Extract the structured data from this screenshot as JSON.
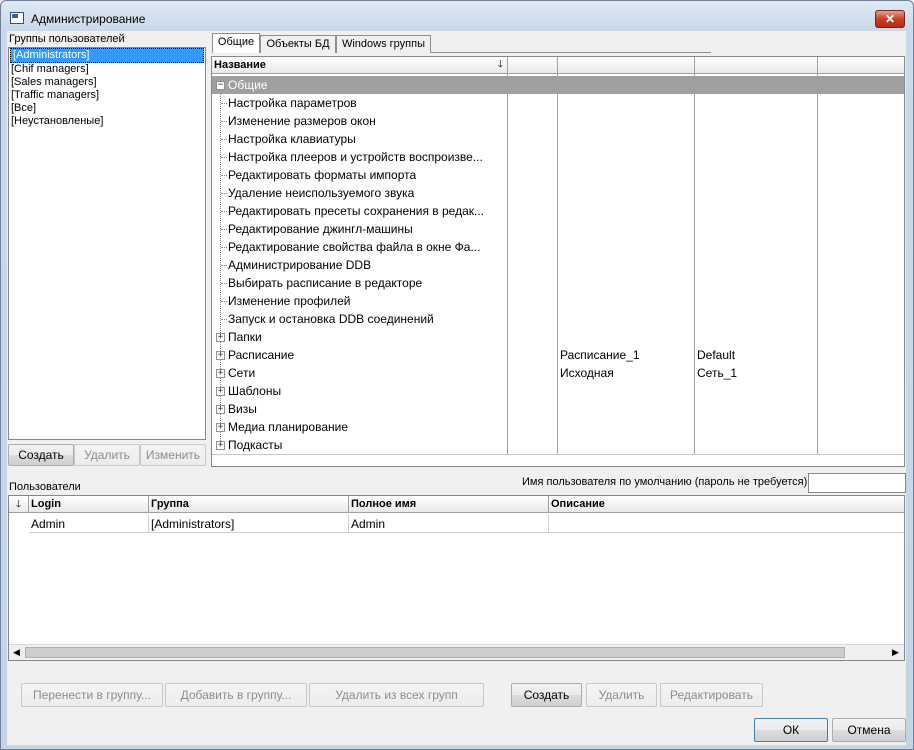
{
  "window": {
    "title": "Администрирование",
    "close_glyph": "✕"
  },
  "groups": {
    "label": "Группы пользователей",
    "items": [
      "[Administrators]",
      "[Chif managers]",
      "[Sales managers]",
      "[Traffic managers]",
      "[Все]",
      "[Неустановленые]"
    ],
    "selected_index": 0,
    "create_label": "Создать",
    "delete_label": "Удалить",
    "edit_label": "Изменить"
  },
  "tabs": [
    {
      "label": "Общие",
      "active": true
    },
    {
      "label": "Объекты БД",
      "active": false
    },
    {
      "label": "Windows группы",
      "active": false
    }
  ],
  "rights": {
    "column_name_header": "Название",
    "sort_glyph": "🡓",
    "rows": [
      {
        "label": "Общие",
        "level": 0,
        "expander": "−",
        "selected": true,
        "col2": "",
        "col3": ""
      },
      {
        "label": "Настройка параметров",
        "level": 1,
        "col2": "",
        "col3": ""
      },
      {
        "label": "Изменение размеров окон",
        "level": 1,
        "col2": "",
        "col3": ""
      },
      {
        "label": "Настройка клавиатуры",
        "level": 1,
        "col2": "",
        "col3": ""
      },
      {
        "label": "Настройка плееров и устройств воспроизве...",
        "level": 1,
        "col2": "",
        "col3": ""
      },
      {
        "label": "Редактировать форматы импорта",
        "level": 1,
        "col2": "",
        "col3": ""
      },
      {
        "label": "Удаление неиспользуемого звука",
        "level": 1,
        "col2": "",
        "col3": ""
      },
      {
        "label": "Редактировать пресеты сохранения в редак...",
        "level": 1,
        "col2": "",
        "col3": ""
      },
      {
        "label": "Редактирование джингл-машины",
        "level": 1,
        "col2": "",
        "col3": ""
      },
      {
        "label": "Редактирование свойства файла в окне Фа...",
        "level": 1,
        "col2": "",
        "col3": ""
      },
      {
        "label": "Администрирование DDB",
        "level": 1,
        "col2": "",
        "col3": ""
      },
      {
        "label": "Выбирать расписание в редакторе",
        "level": 1,
        "col2": "",
        "col3": ""
      },
      {
        "label": "Изменение профилей",
        "level": 1,
        "col2": "",
        "col3": ""
      },
      {
        "label": "Запуск и остановка DDB соединений",
        "level": 1,
        "col2": "",
        "col3": ""
      },
      {
        "label": "Папки",
        "level": 0,
        "expander": "+",
        "col2": "",
        "col3": ""
      },
      {
        "label": "Расписание",
        "level": 0,
        "expander": "+",
        "col2": "Расписание_1",
        "col3": "Default"
      },
      {
        "label": "Сети",
        "level": 0,
        "expander": "+",
        "col2": "Исходная",
        "col3": "Сеть_1"
      },
      {
        "label": "Шаблоны",
        "level": 0,
        "expander": "+",
        "col2": "",
        "col3": ""
      },
      {
        "label": "Визы",
        "level": 0,
        "expander": "+",
        "col2": "",
        "col3": ""
      },
      {
        "label": "Медиа планирование",
        "level": 0,
        "expander": "+",
        "col2": "",
        "col3": ""
      },
      {
        "label": "Подкасты",
        "level": 0,
        "expander": "+",
        "col2": "",
        "col3": ""
      }
    ]
  },
  "users": {
    "label": "Пользователи",
    "default_user_label": "Имя пользователя по умолчанию (пароль не требуется)",
    "default_user_value": "",
    "sort_glyph": "🡓",
    "columns": [
      "Login",
      "Группа",
      "Полное имя",
      "Описание"
    ],
    "rows": [
      [
        "Admin",
        "[Administrators]",
        "Admin",
        ""
      ]
    ],
    "scroll_left": "◀",
    "scroll_right": "▶"
  },
  "actions": {
    "move_to_group": "Перенести в группу...",
    "add_to_group": "Добавить в группу...",
    "remove_from_all": "Удалить из всех групп",
    "create": "Создать",
    "delete": "Удалить",
    "edit": "Редактировать",
    "ok": "ОК",
    "cancel": "Отмена"
  },
  "colors": {
    "selection_blue": "#3399ff",
    "tree_selected_row": "#a0a0a0",
    "close_red": "#c8402c"
  }
}
